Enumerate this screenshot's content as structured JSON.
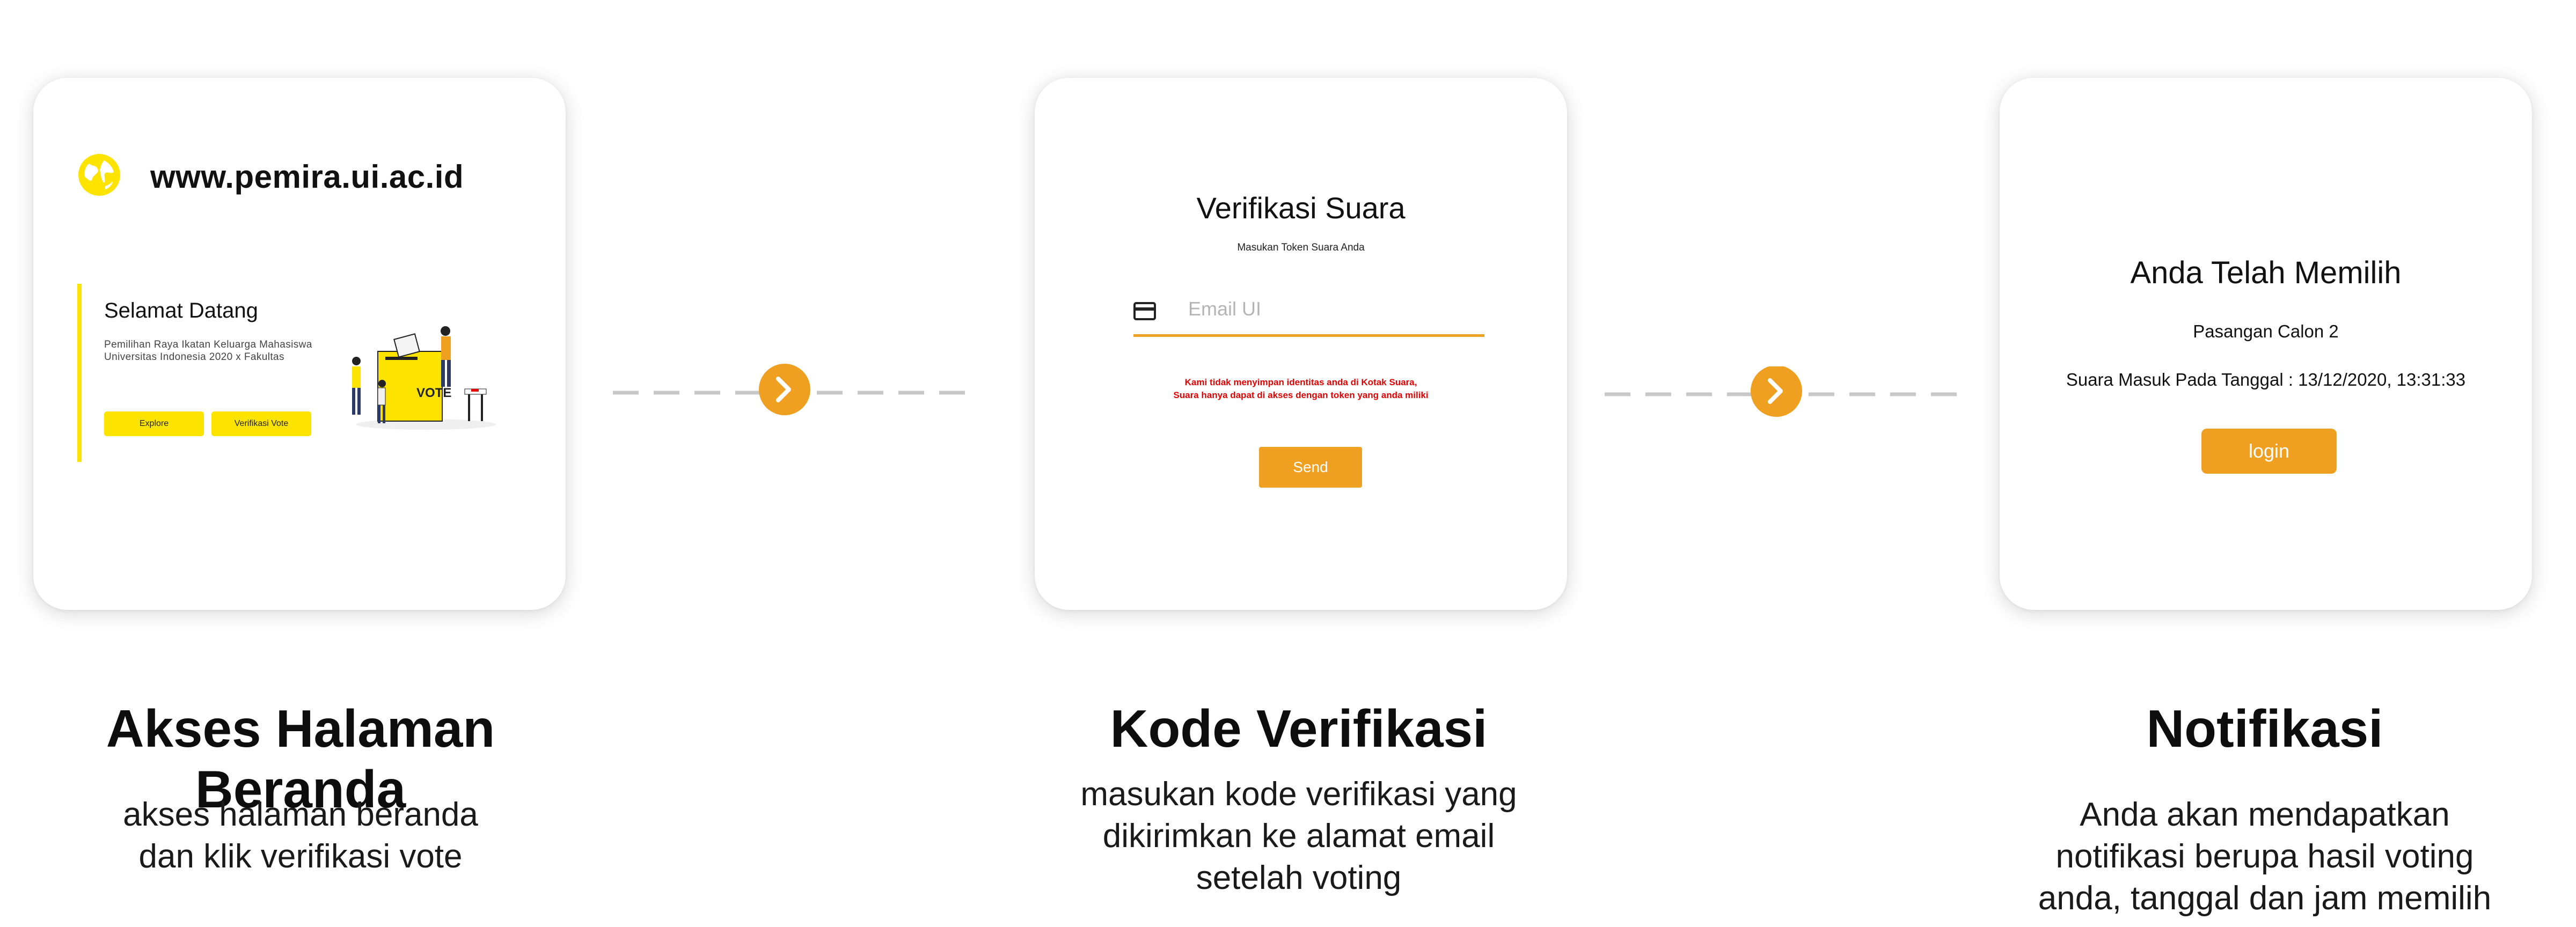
{
  "screens": [
    {
      "url": "www.pemira.ui.ac.id",
      "welcome_title": "Selamat Datang",
      "welcome_desc": "Pemilihan Raya Ikatan Keluarga Mahasiswa Universitas Indonesia 2020 x Fakultas",
      "explore_label": "Explore",
      "verify_vote_label": "Verifikasi Vote",
      "illustration_text": "VOTE"
    },
    {
      "title": "Verifikasi Suara",
      "subtitle": "Masukan Token Suara Anda",
      "email_placeholder": "Email UI",
      "note_line1": "Kami tidak menyimpan identitas anda di Kotak Suara,",
      "note_line2": "Suara hanya dapat di akses dengan token yang anda miliki",
      "send_label": "Send"
    },
    {
      "title": "Anda Telah Memilih",
      "candidate": "Pasangan Calon 2",
      "timestamp": "Suara Masuk Pada Tanggal : 13/12/2020, 13:31:33",
      "login_label": "login"
    }
  ],
  "captions": [
    {
      "title": "Akses Halaman Beranda",
      "line1": "akses halaman beranda",
      "line2": "dan klik verifikasi vote"
    },
    {
      "title": "Kode Verifikasi",
      "line1": "masukan kode verifikasi yang",
      "line2": "dikirimkan ke alamat email",
      "line3": "setelah voting"
    },
    {
      "title": "Notifikasi",
      "line1": "Anda akan mendapatkan",
      "line2": "notifikasi berupa hasil voting",
      "line3": "anda, tanggal dan jam memilih"
    }
  ],
  "colors": {
    "accent_orange": "#f0a020",
    "accent_yellow": "#fde300",
    "note_red": "#e60000",
    "dash_gray": "#c8c8c8"
  },
  "icons": {
    "site": "globe-icon",
    "email": "credit-card-icon",
    "next": "chevron-right-icon"
  }
}
